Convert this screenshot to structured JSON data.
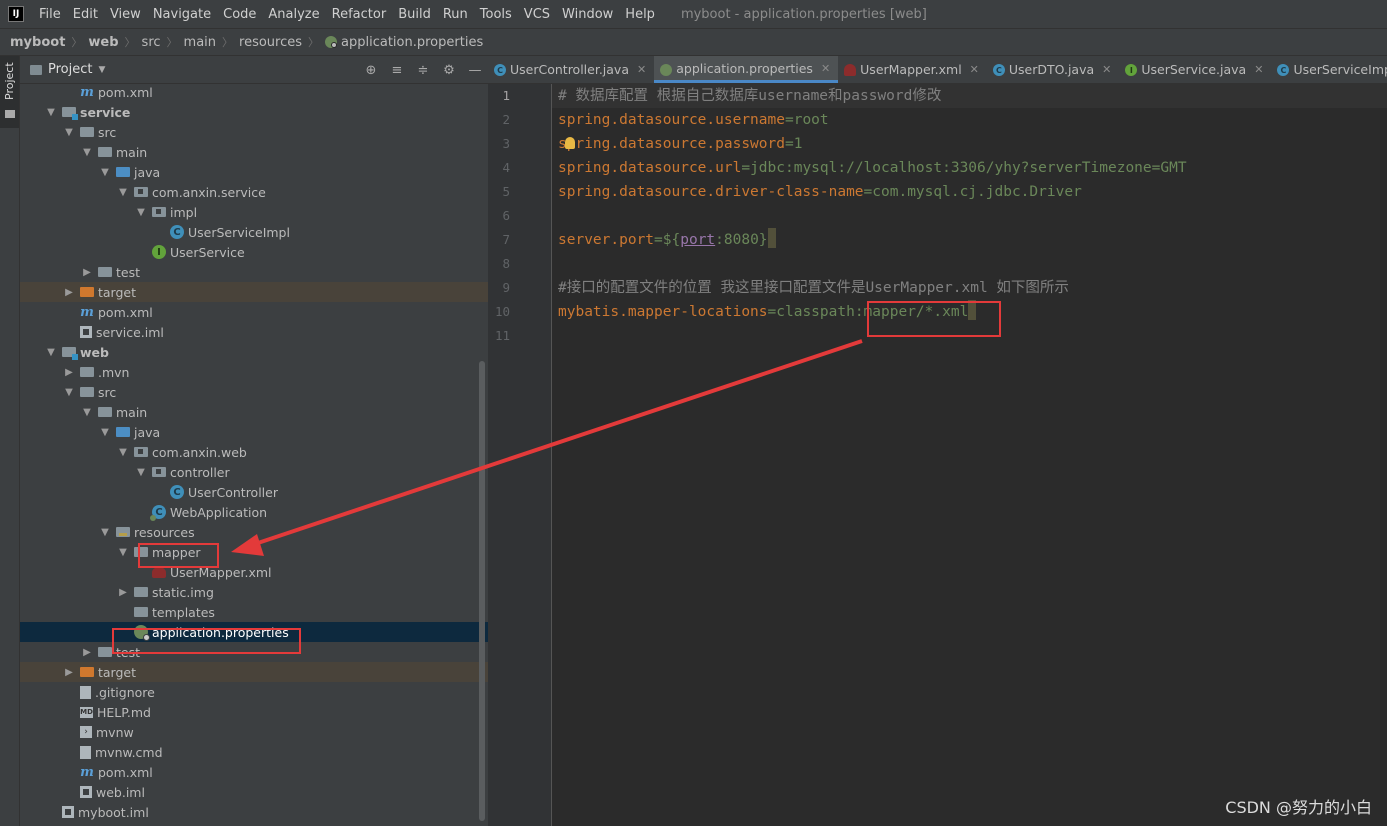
{
  "menubar": {
    "items": [
      "File",
      "Edit",
      "View",
      "Navigate",
      "Code",
      "Analyze",
      "Refactor",
      "Build",
      "Run",
      "Tools",
      "VCS",
      "Window",
      "Help"
    ],
    "title": "myboot - application.properties [web]"
  },
  "breadcrumb": [
    "myboot",
    "web",
    "src",
    "main",
    "resources",
    "application.properties"
  ],
  "strip": {
    "label": "Project"
  },
  "project": {
    "title": "Project",
    "tree": [
      "pom.xml",
      "service",
      "src",
      "main",
      "java",
      "com.anxin.service",
      "impl",
      "UserServiceImpl",
      "UserService",
      "test",
      "target",
      "pom.xml",
      "service.iml",
      "web",
      ".mvn",
      "src",
      "main",
      "java",
      "com.anxin.web",
      "controller",
      "UserController",
      "WebApplication",
      "resources",
      "mapper",
      "UserMapper.xml",
      "static.img",
      "templates",
      "application.properties",
      "test",
      "target",
      ".gitignore",
      "HELP.md",
      "mvnw",
      "mvnw.cmd",
      "pom.xml",
      "web.iml",
      "myboot.iml"
    ]
  },
  "tabs": [
    "UserController.java",
    "application.properties",
    "UserMapper.xml",
    "UserDTO.java",
    "UserService.java",
    "UserServiceImpl.java"
  ],
  "code": {
    "line_numbers": [
      "1",
      "2",
      "3",
      "4",
      "5",
      "6",
      "7",
      "8",
      "9",
      "10",
      "11"
    ],
    "l1_comment": "# 数据库配置 根据自己数据库username和password修改",
    "l2_key": "spring.datasource.username",
    "l2_eq": "=",
    "l2_val": "root",
    "l3_key": "spring.datasource.password",
    "l3_eq": "=",
    "l3_val": "1",
    "l4_key": "spring.datasource.url",
    "l4_eq": "=",
    "l4_val": "jdbc:mysql://localhost:3306/yhy?serverTimezone=GMT",
    "l5_key": "spring.datasource.driver-class-name",
    "l5_eq": "=",
    "l5_val": "com.mysql.cj.jdbc.Driver",
    "l7_key": "server.port",
    "l7_eq": "=",
    "l7_val_a": "${",
    "l7_ph": "port",
    "l7_val_b": ":8080}",
    "l9_comment": "#接口的配置文件的位置 我这里接口配置文件是UserMapper.xml 如下图所示",
    "l10_key": "mybatis.mapper-locations",
    "l10_eq": "=",
    "l10_val": "classpath:mapper/*.xml"
  },
  "watermark": "CSDN @努力的小白",
  "colors": {
    "annotation": "#e33a3a",
    "keyword": "#cc7832",
    "value": "#6a8759",
    "comment": "#808080"
  }
}
